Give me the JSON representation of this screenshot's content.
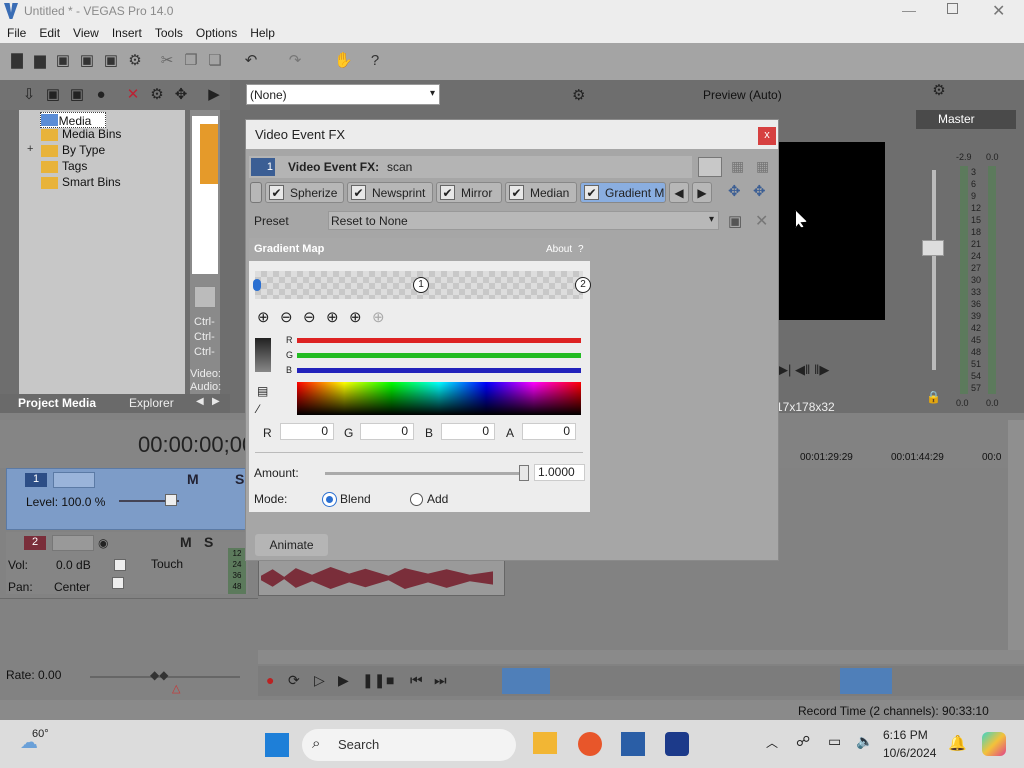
{
  "window": {
    "title": "Untitled * - VEGAS Pro 14.0"
  },
  "menu": [
    "File",
    "Edit",
    "View",
    "Insert",
    "Tools",
    "Options",
    "Help"
  ],
  "toolbar": {
    "preview_mode": "(None)",
    "preview_quality": "Preview (Auto)"
  },
  "project_media": {
    "tree": [
      "All Media",
      "Media Bins",
      "By Type",
      "Tags",
      "Smart Bins"
    ],
    "expander": "+",
    "tabs": [
      "Project Media",
      "Explorer"
    ],
    "side_texts": [
      "Ctrl-",
      "Ctrl-",
      "Ctrl-",
      "Video:",
      "Audio:"
    ]
  },
  "video_preview": {
    "resolution": "17x178x32"
  },
  "master": {
    "label": "Master",
    "db_left": "-2.9",
    "db_right": "0.0",
    "scale": [
      "3",
      "6",
      "9",
      "12",
      "15",
      "18",
      "21",
      "24",
      "27",
      "30",
      "33",
      "36",
      "39",
      "42",
      "45",
      "48",
      "51",
      "54",
      "57"
    ],
    "bottom_left": "0.0",
    "bottom_right": "0.0"
  },
  "timeline": {
    "timecode": "00:00:00;00",
    "ruler": [
      "00:01:29:29",
      "00:01:44:29",
      "00:0"
    ],
    "rate": "Rate: 0.00"
  },
  "track1": {
    "num": "1",
    "level": "Level: 100.0 %"
  },
  "track2": {
    "num": "2",
    "vol_label": "Vol:",
    "vol_value": "0.0 dB",
    "pan_label": "Pan:",
    "pan_value": "Center",
    "mode": "Touch",
    "meter": [
      "12",
      "24",
      "36",
      "48"
    ]
  },
  "dialog": {
    "title": "Video Event FX",
    "close": "x",
    "chain_num": "1",
    "chain_label": "Video Event FX:",
    "chain_name": "scan",
    "fx": [
      "Spherize",
      "Newsprint",
      "Mirror",
      "Median",
      "Gradient M"
    ],
    "preset_label": "Preset",
    "preset_value": "Reset to None",
    "animate": "Animate"
  },
  "gradient_map": {
    "title": "Gradient Map",
    "about": "About",
    "help": "?",
    "stops": [
      "1",
      "2"
    ],
    "channels": [
      "R",
      "G",
      "B"
    ],
    "fields": [
      {
        "label": "R",
        "value": "0"
      },
      {
        "label": "G",
        "value": "0"
      },
      {
        "label": "B",
        "value": "0"
      },
      {
        "label": "A",
        "value": "0"
      }
    ],
    "amount_label": "Amount:",
    "amount_value": "1.0000",
    "amount": 1.0,
    "mode_label": "Mode:",
    "mode_options": [
      "Blend",
      "Add"
    ],
    "mode_selected": "Blend"
  },
  "status": {
    "record_time": "Record Time (2 channels): 90:33:10"
  },
  "taskbar": {
    "weather": "60°",
    "search": "Search",
    "time": "6:16 PM",
    "date": "10/6/2024"
  },
  "colors": {
    "accent": "#4f7fb9",
    "track_blue": "#7d9cc8",
    "waveform": "#7a2e3a"
  }
}
